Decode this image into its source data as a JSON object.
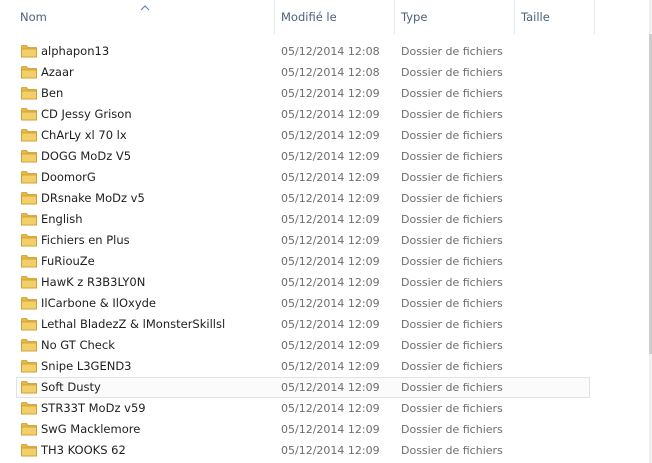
{
  "columns": {
    "name": "Nom",
    "modified": "Modifié le",
    "type": "Type",
    "size": "Taille"
  },
  "sort": {
    "column": "name",
    "direction": "ascending"
  },
  "colors": {
    "header_text": "#4c607a",
    "folder": "#e8b942",
    "hover_border": "#e2e2e2"
  },
  "rows": [
    {
      "name": "alphapon13",
      "modified": "05/12/2014 12:08",
      "type": "Dossier de fichiers",
      "size": ""
    },
    {
      "name": "Azaar",
      "modified": "05/12/2014 12:08",
      "type": "Dossier de fichiers",
      "size": ""
    },
    {
      "name": "Ben",
      "modified": "05/12/2014 12:09",
      "type": "Dossier de fichiers",
      "size": ""
    },
    {
      "name": "CD Jessy Grison",
      "modified": "05/12/2014 12:09",
      "type": "Dossier de fichiers",
      "size": ""
    },
    {
      "name": "ChArLy xl 70 lx",
      "modified": "05/12/2014 12:09",
      "type": "Dossier de fichiers",
      "size": ""
    },
    {
      "name": "DOGG MoDz V5",
      "modified": "05/12/2014 12:09",
      "type": "Dossier de fichiers",
      "size": ""
    },
    {
      "name": "DoomorG",
      "modified": "05/12/2014 12:09",
      "type": "Dossier de fichiers",
      "size": ""
    },
    {
      "name": "DRsnake MoDz v5",
      "modified": "05/12/2014 12:09",
      "type": "Dossier de fichiers",
      "size": ""
    },
    {
      "name": "English",
      "modified": "05/12/2014 12:09",
      "type": "Dossier de fichiers",
      "size": ""
    },
    {
      "name": "Fichiers en Plus",
      "modified": "05/12/2014 12:09",
      "type": "Dossier de fichiers",
      "size": ""
    },
    {
      "name": "FuRiouZe",
      "modified": "05/12/2014 12:09",
      "type": "Dossier de fichiers",
      "size": ""
    },
    {
      "name": "HawK z R3B3LY0N",
      "modified": "05/12/2014 12:09",
      "type": "Dossier de fichiers",
      "size": ""
    },
    {
      "name": "IlCarbone & IlOxyde",
      "modified": "05/12/2014 12:09",
      "type": "Dossier de fichiers",
      "size": ""
    },
    {
      "name": "Lethal BladezZ & lMonsterSkillsl",
      "modified": "05/12/2014 12:09",
      "type": "Dossier de fichiers",
      "size": ""
    },
    {
      "name": "No GT Check",
      "modified": "05/12/2014 12:09",
      "type": "Dossier de fichiers",
      "size": ""
    },
    {
      "name": "Snipe L3GEND3",
      "modified": "05/12/2014 12:09",
      "type": "Dossier de fichiers",
      "size": ""
    },
    {
      "name": "Soft Dusty",
      "modified": "05/12/2014 12:09",
      "type": "Dossier de fichiers",
      "size": "",
      "hover": true
    },
    {
      "name": "STR33T MoDz v59",
      "modified": "05/12/2014 12:09",
      "type": "Dossier de fichiers",
      "size": ""
    },
    {
      "name": "SwG Macklemore",
      "modified": "05/12/2014 12:09",
      "type": "Dossier de fichiers",
      "size": ""
    },
    {
      "name": "TH3 KOOKS 62",
      "modified": "05/12/2014 12:09",
      "type": "Dossier de fichiers",
      "size": ""
    }
  ]
}
